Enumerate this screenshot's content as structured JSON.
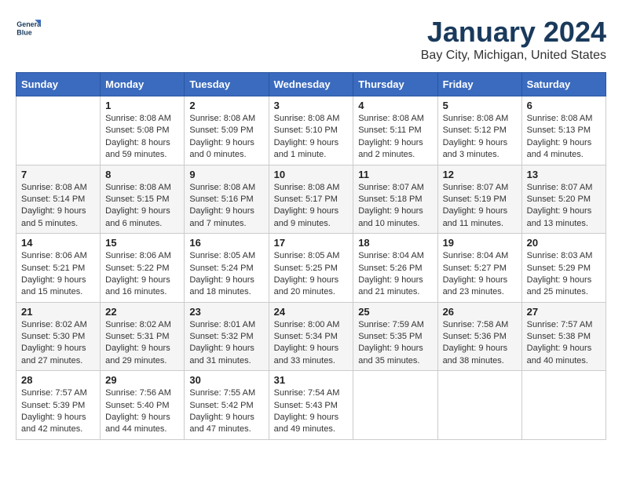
{
  "header": {
    "logo_line1": "General",
    "logo_line2": "Blue",
    "month_year": "January 2024",
    "location": "Bay City, Michigan, United States"
  },
  "weekdays": [
    "Sunday",
    "Monday",
    "Tuesday",
    "Wednesday",
    "Thursday",
    "Friday",
    "Saturday"
  ],
  "weeks": [
    [
      {
        "day": "",
        "info": ""
      },
      {
        "day": "1",
        "info": "Sunrise: 8:08 AM\nSunset: 5:08 PM\nDaylight: 8 hours\nand 59 minutes."
      },
      {
        "day": "2",
        "info": "Sunrise: 8:08 AM\nSunset: 5:09 PM\nDaylight: 9 hours\nand 0 minutes."
      },
      {
        "day": "3",
        "info": "Sunrise: 8:08 AM\nSunset: 5:10 PM\nDaylight: 9 hours\nand 1 minute."
      },
      {
        "day": "4",
        "info": "Sunrise: 8:08 AM\nSunset: 5:11 PM\nDaylight: 9 hours\nand 2 minutes."
      },
      {
        "day": "5",
        "info": "Sunrise: 8:08 AM\nSunset: 5:12 PM\nDaylight: 9 hours\nand 3 minutes."
      },
      {
        "day": "6",
        "info": "Sunrise: 8:08 AM\nSunset: 5:13 PM\nDaylight: 9 hours\nand 4 minutes."
      }
    ],
    [
      {
        "day": "7",
        "info": "Sunrise: 8:08 AM\nSunset: 5:14 PM\nDaylight: 9 hours\nand 5 minutes."
      },
      {
        "day": "8",
        "info": "Sunrise: 8:08 AM\nSunset: 5:15 PM\nDaylight: 9 hours\nand 6 minutes."
      },
      {
        "day": "9",
        "info": "Sunrise: 8:08 AM\nSunset: 5:16 PM\nDaylight: 9 hours\nand 7 minutes."
      },
      {
        "day": "10",
        "info": "Sunrise: 8:08 AM\nSunset: 5:17 PM\nDaylight: 9 hours\nand 9 minutes."
      },
      {
        "day": "11",
        "info": "Sunrise: 8:07 AM\nSunset: 5:18 PM\nDaylight: 9 hours\nand 10 minutes."
      },
      {
        "day": "12",
        "info": "Sunrise: 8:07 AM\nSunset: 5:19 PM\nDaylight: 9 hours\nand 11 minutes."
      },
      {
        "day": "13",
        "info": "Sunrise: 8:07 AM\nSunset: 5:20 PM\nDaylight: 9 hours\nand 13 minutes."
      }
    ],
    [
      {
        "day": "14",
        "info": "Sunrise: 8:06 AM\nSunset: 5:21 PM\nDaylight: 9 hours\nand 15 minutes."
      },
      {
        "day": "15",
        "info": "Sunrise: 8:06 AM\nSunset: 5:22 PM\nDaylight: 9 hours\nand 16 minutes."
      },
      {
        "day": "16",
        "info": "Sunrise: 8:05 AM\nSunset: 5:24 PM\nDaylight: 9 hours\nand 18 minutes."
      },
      {
        "day": "17",
        "info": "Sunrise: 8:05 AM\nSunset: 5:25 PM\nDaylight: 9 hours\nand 20 minutes."
      },
      {
        "day": "18",
        "info": "Sunrise: 8:04 AM\nSunset: 5:26 PM\nDaylight: 9 hours\nand 21 minutes."
      },
      {
        "day": "19",
        "info": "Sunrise: 8:04 AM\nSunset: 5:27 PM\nDaylight: 9 hours\nand 23 minutes."
      },
      {
        "day": "20",
        "info": "Sunrise: 8:03 AM\nSunset: 5:29 PM\nDaylight: 9 hours\nand 25 minutes."
      }
    ],
    [
      {
        "day": "21",
        "info": "Sunrise: 8:02 AM\nSunset: 5:30 PM\nDaylight: 9 hours\nand 27 minutes."
      },
      {
        "day": "22",
        "info": "Sunrise: 8:02 AM\nSunset: 5:31 PM\nDaylight: 9 hours\nand 29 minutes."
      },
      {
        "day": "23",
        "info": "Sunrise: 8:01 AM\nSunset: 5:32 PM\nDaylight: 9 hours\nand 31 minutes."
      },
      {
        "day": "24",
        "info": "Sunrise: 8:00 AM\nSunset: 5:34 PM\nDaylight: 9 hours\nand 33 minutes."
      },
      {
        "day": "25",
        "info": "Sunrise: 7:59 AM\nSunset: 5:35 PM\nDaylight: 9 hours\nand 35 minutes."
      },
      {
        "day": "26",
        "info": "Sunrise: 7:58 AM\nSunset: 5:36 PM\nDaylight: 9 hours\nand 38 minutes."
      },
      {
        "day": "27",
        "info": "Sunrise: 7:57 AM\nSunset: 5:38 PM\nDaylight: 9 hours\nand 40 minutes."
      }
    ],
    [
      {
        "day": "28",
        "info": "Sunrise: 7:57 AM\nSunset: 5:39 PM\nDaylight: 9 hours\nand 42 minutes."
      },
      {
        "day": "29",
        "info": "Sunrise: 7:56 AM\nSunset: 5:40 PM\nDaylight: 9 hours\nand 44 minutes."
      },
      {
        "day": "30",
        "info": "Sunrise: 7:55 AM\nSunset: 5:42 PM\nDaylight: 9 hours\nand 47 minutes."
      },
      {
        "day": "31",
        "info": "Sunrise: 7:54 AM\nSunset: 5:43 PM\nDaylight: 9 hours\nand 49 minutes."
      },
      {
        "day": "",
        "info": ""
      },
      {
        "day": "",
        "info": ""
      },
      {
        "day": "",
        "info": ""
      }
    ]
  ]
}
